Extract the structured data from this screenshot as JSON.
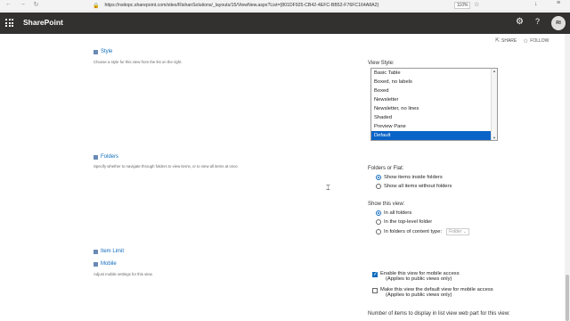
{
  "browser": {
    "url": "https://nsitopc.sharepoint.com/sites/RishanSolutions/_layouts/15/ViewNew.aspx?List={801DF925-CB42-4EFC-BB52-F76FC164A8A2}",
    "zoom": "110%",
    "icons": [
      "back-icon",
      "forward-icon",
      "refresh-icon",
      "lock-icon",
      "star-icon",
      "download-icon",
      "menu-icon"
    ]
  },
  "suite": {
    "title": "SharePoint",
    "avatar": "RI",
    "icons": [
      "waffle-icon",
      "gear-icon",
      "help-icon"
    ]
  },
  "actions": {
    "share": "SHARE",
    "follow": "FOLLOW"
  },
  "style": {
    "title": "Style",
    "desc": "Choose a style for this view from the list on the right.",
    "label": "View Style:",
    "options": [
      "Basic Table",
      "Boxed, no labels",
      "Boxed",
      "Newsletter",
      "Newsletter, no lines",
      "Shaded",
      "Preview Pane",
      "Default"
    ],
    "selected": "Default"
  },
  "folders": {
    "title": "Folders",
    "desc": "Specify whether to navigate through folders to view items, or to view all items at once.",
    "flat_label": "Folders or Flat:",
    "flat_opts": [
      "Show items inside folders",
      "Show all items without folders"
    ],
    "flat_selected": 0,
    "show_label": "Show this view:",
    "show_opts": [
      "In all folders",
      "In the top-level folder",
      "In folders of content type:"
    ],
    "show_selected": 0,
    "content_type_value": "Folder"
  },
  "item_limit": {
    "title": "Item Limit"
  },
  "mobile": {
    "title": "Mobile",
    "desc": "Adjust mobile settings for this view.",
    "enable_label": "Enable this view for mobile access",
    "enable_sub": "(Applies to public views only)",
    "enable_checked": true,
    "default_label": "Make this view the default view for mobile access",
    "default_sub": "(Applies to public views only)",
    "default_checked": false,
    "number_label": "Number of items to display in list view web part for this view:"
  }
}
